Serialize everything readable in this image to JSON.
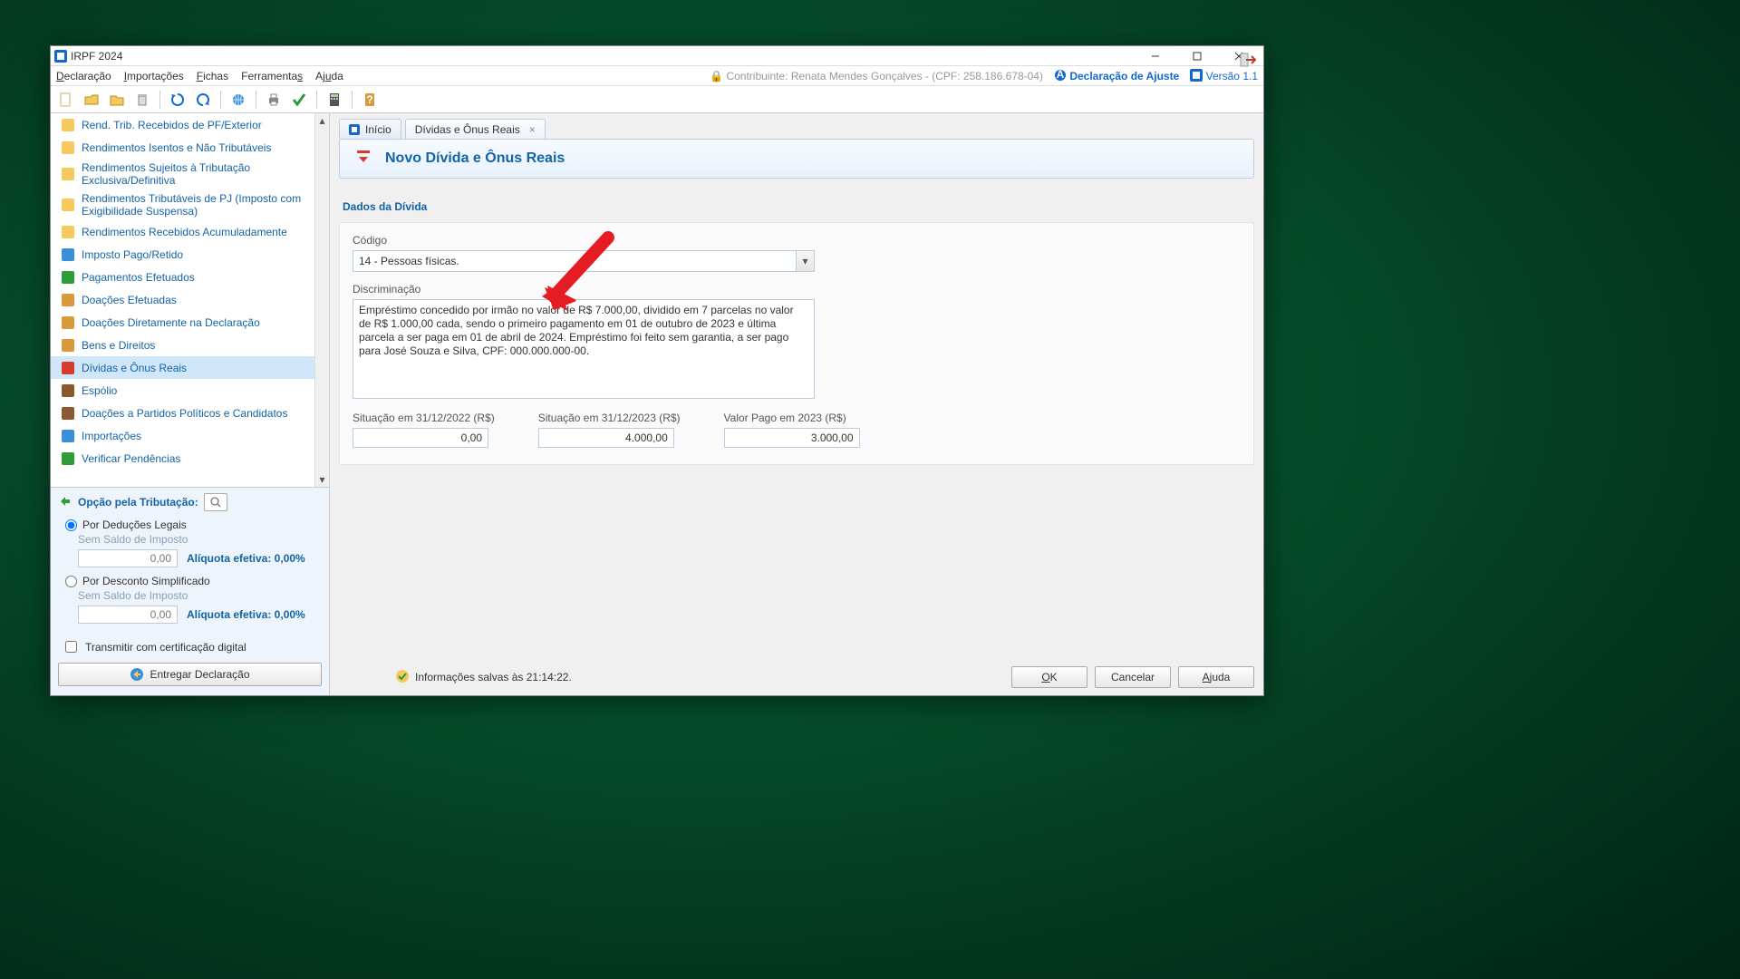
{
  "window": {
    "title": "IRPF 2024"
  },
  "menu": {
    "items": [
      "Declaração",
      "Importações",
      "Fichas",
      "Ferramentas",
      "Ajuda"
    ],
    "contribuinte_label": "Contribuinte: Renata Mendes Gonçalves - (CPF: 258.186.678-04)",
    "ajuste_label": "Declaração de Ajuste",
    "version_label": "Versão 1.1"
  },
  "sidebar": {
    "items": [
      {
        "label": "Rend. Trib. Recebidos de PF/Exterior",
        "two": false
      },
      {
        "label": "Rendimentos Isentos e Não Tributáveis",
        "two": false
      },
      {
        "label": "Rendimentos Sujeitos à Tributação Exclusiva/Definitiva",
        "two": true
      },
      {
        "label": "Rendimentos Tributáveis de PJ (Imposto com Exigibilidade Suspensa)",
        "two": true
      },
      {
        "label": "Rendimentos Recebidos Acumuladamente",
        "two": false
      },
      {
        "label": "Imposto Pago/Retido",
        "two": false
      },
      {
        "label": "Pagamentos Efetuados",
        "two": false
      },
      {
        "label": "Doações Efetuadas",
        "two": false
      },
      {
        "label": "Doações Diretamente na Declaração",
        "two": false
      },
      {
        "label": "Bens e Direitos",
        "two": false
      },
      {
        "label": "Dívidas e Ônus Reais",
        "two": false,
        "active": true
      },
      {
        "label": "Espólio",
        "two": false
      },
      {
        "label": "Doações a Partidos Políticos e Candidatos",
        "two": false
      },
      {
        "label": "Importações",
        "two": false
      },
      {
        "label": "Verificar Pendências",
        "two": false
      }
    ],
    "tax": {
      "title": "Opção pela Tributação:",
      "opt1": "Por Deduções Legais",
      "opt2": "Por Desconto Simplificado",
      "no_balance": "Sem Saldo de Imposto",
      "value1": "0,00",
      "aliq1": "Alíquota efetiva: 0,00%",
      "value2": "0,00",
      "aliq2": "Alíquota efetiva: 0,00%",
      "transmit": "Transmitir com certificação digital",
      "deliver": "Entregar Declaração"
    }
  },
  "tabs": {
    "home": "Início",
    "active": "Dívidas e Ônus Reais"
  },
  "banner": {
    "title": "Novo Dívida e Ônus Reais"
  },
  "form": {
    "section": "Dados da Dívida",
    "codigo_label": "Código",
    "codigo_value": "14 - Pessoas físicas.",
    "discr_label": "Discriminação",
    "discr_value": "Empréstimo concedido por irmão no valor de R$ 7.000,00, dividido em 7 parcelas no valor de R$ 1.000,00 cada, sendo o primeiro pagamento em 01 de outubro de 2023 e última parcela a ser paga em 01 de abril de 2024. Empréstimo foi feito sem garantia, a ser pago para José Souza e Silva, CPF: 000.000.000-00.",
    "col1_label": "Situação em 31/12/2022 (R$)",
    "col1_value": "0,00",
    "col2_label": "Situação em 31/12/2023 (R$)",
    "col2_value": "4.000,00",
    "col3_label": "Valor Pago em 2023 (R$)",
    "col3_value": "3.000,00"
  },
  "status": {
    "text": "Informações salvas às 21:14:22."
  },
  "buttons": {
    "ok": "OK",
    "cancel": "Cancelar",
    "help": "Ajuda"
  }
}
